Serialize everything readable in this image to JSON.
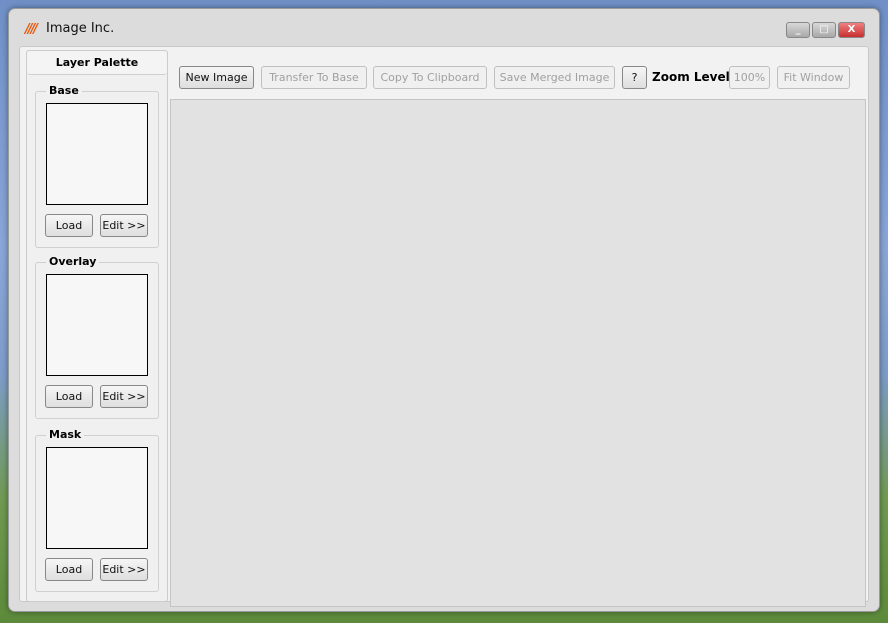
{
  "window": {
    "title": "Image Inc.",
    "app_icon": "stripes-logo-icon",
    "controls": [
      "minimize",
      "maximize",
      "close"
    ]
  },
  "palette": {
    "title": "Layer Palette",
    "groups": [
      {
        "label": "Base",
        "load": "Load",
        "edit": "Edit >>"
      },
      {
        "label": "Overlay",
        "load": "Load",
        "edit": "Edit >>"
      },
      {
        "label": "Mask",
        "load": "Load",
        "edit": "Edit >>"
      }
    ]
  },
  "toolbar": {
    "new_image": "New Image",
    "transfer_to_base": "Transfer To Base",
    "copy_to_clipboard": "Copy To Clipboard",
    "save_merged": "Save Merged Image",
    "help": "?",
    "zoom_label": "Zoom Level",
    "zoom_100": "100%",
    "fit_window": "Fit Window"
  }
}
